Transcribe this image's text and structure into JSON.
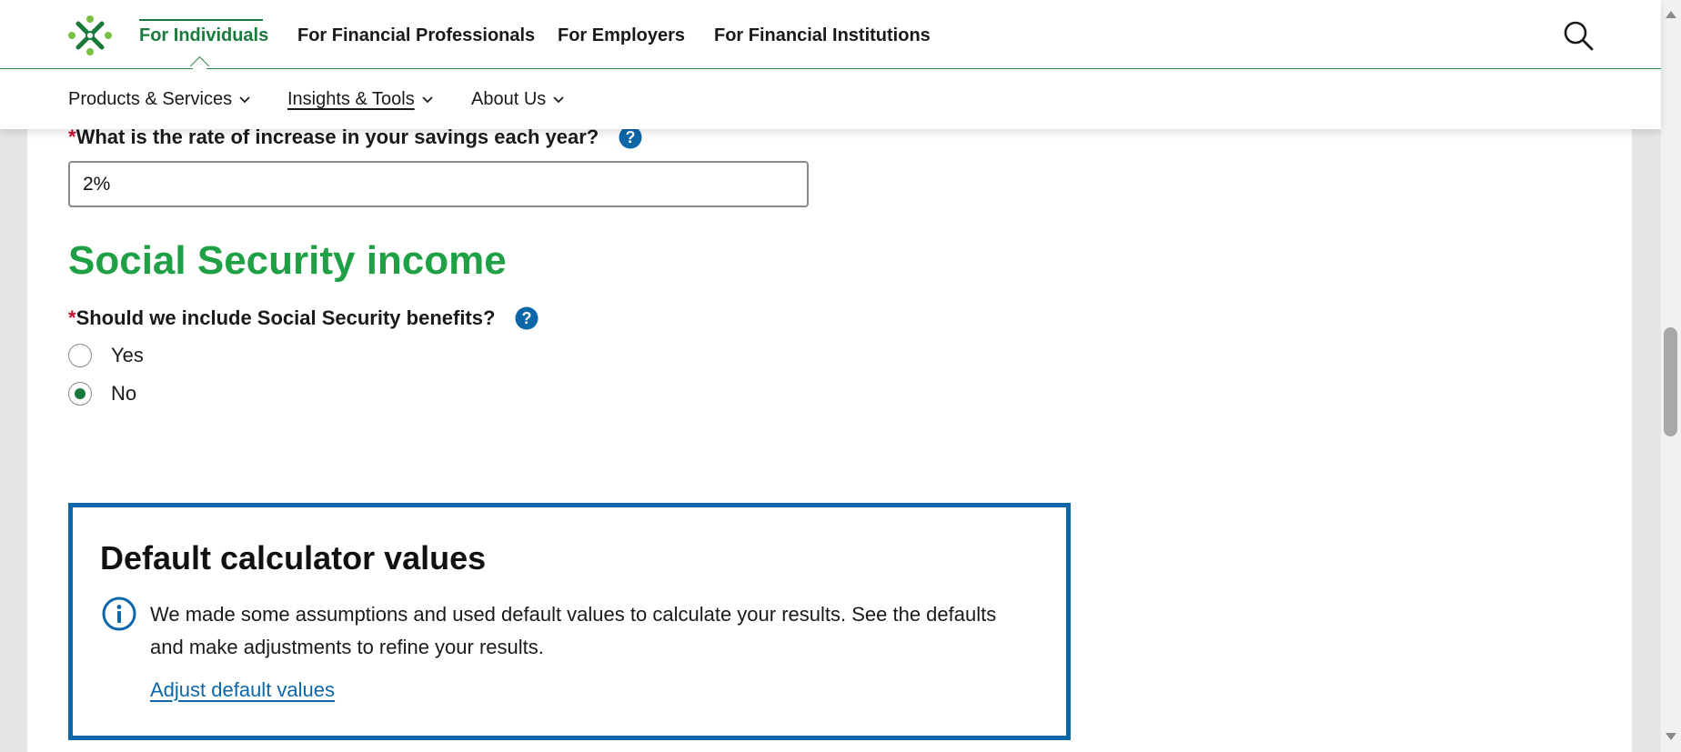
{
  "header": {
    "top_nav": [
      {
        "label": "For Individuals",
        "active": true
      },
      {
        "label": "For Financial Professionals",
        "active": false
      },
      {
        "label": "For Employers",
        "active": false
      },
      {
        "label": "For Financial Institutions",
        "active": false
      }
    ],
    "sub_nav": [
      {
        "label": "Products & Services"
      },
      {
        "label": "Insights & Tools"
      },
      {
        "label": "About Us"
      }
    ],
    "search_icon": "search-icon"
  },
  "form": {
    "savings_increase": {
      "required_mark": "*",
      "question": "What is the rate of increase in your savings each year?",
      "value": "2%"
    },
    "social_security": {
      "section_title": "Social Security income",
      "required_mark": "*",
      "question": "Should we include Social Security benefits?",
      "options": [
        {
          "label": "Yes",
          "checked": false
        },
        {
          "label": "No",
          "checked": true
        }
      ]
    }
  },
  "defaults_box": {
    "title": "Default calculator values",
    "text": "We made some assumptions and used default values to calculate your results. See the defaults and make adjustments to refine your results.",
    "link": "Adjust default values"
  },
  "colors": {
    "brand_green": "#1a7a3c",
    "section_green": "#1fa045",
    "link_blue": "#0b67a8",
    "required_red": "#c8102e"
  }
}
